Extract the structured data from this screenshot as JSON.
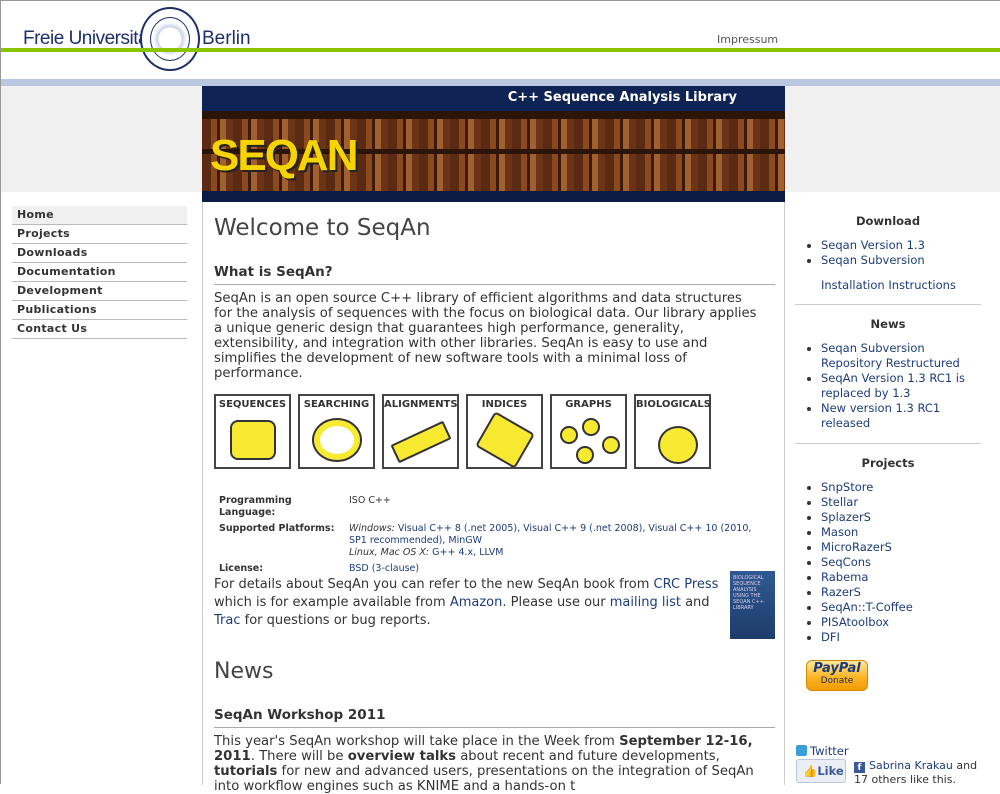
{
  "header": {
    "university_left": "Freie Universität",
    "university_right": "Berlin",
    "impressum": "Impressum"
  },
  "banner": {
    "title": "C++ Sequence Analysis Library",
    "logo": "SEQAN"
  },
  "nav": [
    {
      "label": "Home",
      "active": true
    },
    {
      "label": "Projects"
    },
    {
      "label": "Downloads"
    },
    {
      "label": "Documentation"
    },
    {
      "label": "Development"
    },
    {
      "label": "Publications"
    },
    {
      "label": "Contact Us"
    }
  ],
  "main": {
    "title": "Welcome to SeqAn",
    "what_heading": "What is SeqAn?",
    "what_text": "SeqAn is an open source C++ library of efficient algorithms and data structures for the analysis of sequences with the focus on biological data. Our library applies a unique generic design that guarantees high performance, generality, extensibility, and integration with other libraries. SeqAn is easy to use and simplifies the development of new software tools with a minimal loss of performance.",
    "icons": [
      "SEQUENCES",
      "SEARCHING",
      "ALIGNMENTS",
      "INDICES",
      "GRAPHS",
      "BIOLOGICALS"
    ],
    "info": {
      "lang_label": "Programming Language:",
      "lang_value": "ISO C++",
      "platforms_label": "Supported Platforms:",
      "windows_label": "Windows:",
      "windows_value": "Visual C++ 8 (.net 2005), Visual C++ 9 (.net 2008), Visual C++ 10 (2010, SP1 recommended), MinGW",
      "unix_label": "Linux, Mac OS X:",
      "unix_value": "G++ 4.x, LLVM",
      "license_label": "License:",
      "license_value": "BSD (3-clause)"
    },
    "book": {
      "t1": "For details about SeqAn you can refer to the new SeqAn book from ",
      "crc": "CRC Press",
      "t2": " which is for example available from ",
      "amazon": "Amazon",
      "t3": ". Please use our ",
      "mailing": "mailing list",
      "t4": " and ",
      "trac": "Trac",
      "t5": " for questions or bug reports.",
      "cover_text": "BIOLOGICAL SEQUENCE ANALYSIS USING THE SEQAN C++ LIBRARY"
    },
    "news_title": "News",
    "workshop_heading": "SeqAn Workshop 2011",
    "workshop": {
      "t1": "This year's SeqAn workshop will take place in the Week from ",
      "date": "September 12-16, 2011",
      "t2": ". There will be ",
      "overview": "overview talks",
      "t3": " about recent and future developments, ",
      "tutorials": "tutorials",
      "t4": " for new and advanced users, presentations on the integration of SeqAn into workflow engines such as KNIME and a hands-on t"
    }
  },
  "sidebar": {
    "download_title": "Download",
    "downloads": [
      "Seqan Version 1.3",
      "Seqan Subversion"
    ],
    "install": "Installation Instructions",
    "news_title": "News",
    "news": [
      "Seqan Subversion Repository Restructured",
      "SeqAn Version 1.3 RC1 is replaced by 1.3",
      "New version 1.3 RC1 released"
    ],
    "projects_title": "Projects",
    "projects": [
      "SnpStore",
      "Stellar",
      "SplazerS",
      "Mason",
      "MicroRazerS",
      "SeqCons",
      "Rabema",
      "RazerS",
      "SeqAn::T-Coffee",
      "PISAtoolbox",
      "DFI"
    ],
    "paypal": "PayPal",
    "donate": "Donate",
    "twitter": "Twitter",
    "like": "Like",
    "fb_name": "Sabrina Krakau",
    "fb_rest": " and 17 others like this."
  }
}
